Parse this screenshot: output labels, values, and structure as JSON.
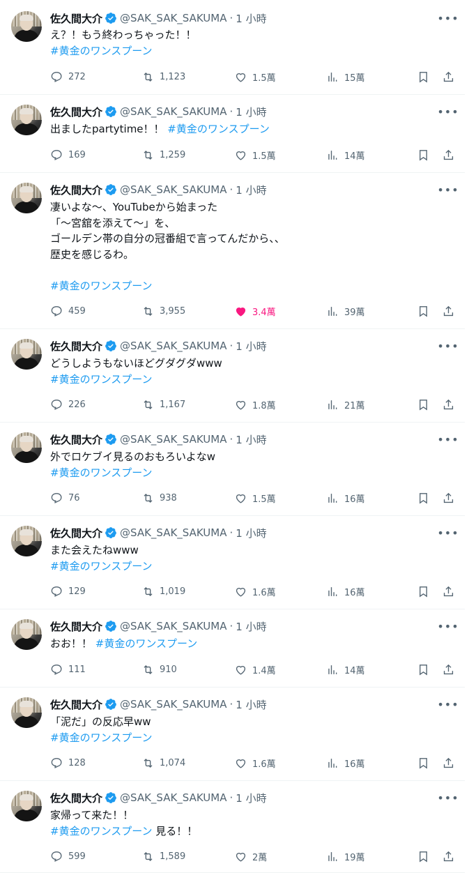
{
  "tweets": [
    {
      "name": "佐久間大介",
      "handle": "@SAK_SAK_SAKUMA",
      "time": "1 小時",
      "lines": [
        "え？！もう終わっちゃった！！"
      ],
      "tag_line": "#黄金のワンスプーン",
      "tag_suffix": "",
      "replies": "272",
      "retweets": "1,123",
      "likes": "1.5萬",
      "views": "15萬",
      "liked": false
    },
    {
      "name": "佐久間大介",
      "handle": "@SAK_SAK_SAKUMA",
      "time": "1 小時",
      "inline_text": "出ましたpartytime！！ ",
      "inline_tag": "#黄金のワンスプーン",
      "replies": "169",
      "retweets": "1,259",
      "likes": "1.5萬",
      "views": "14萬",
      "liked": false
    },
    {
      "name": "佐久間大介",
      "handle": "@SAK_SAK_SAKUMA",
      "time": "1 小時",
      "lines": [
        "凄いよな〜、YouTubeから始まった",
        "「〜宮舘を添えて〜」を、",
        "ゴールデン帯の自分の冠番組で言ってんだから、、",
        "歴史を感じるわ。"
      ],
      "tag_line": "#黄金のワンスプーン",
      "tag_suffix": "",
      "replies": "459",
      "retweets": "3,955",
      "likes": "3.4萬",
      "views": "39萬",
      "liked": true
    },
    {
      "name": "佐久間大介",
      "handle": "@SAK_SAK_SAKUMA",
      "time": "1 小時",
      "lines": [
        "どうしようもないほどグダグダwww"
      ],
      "tag_line": "#黄金のワンスプーン",
      "tag_suffix": "",
      "replies": "226",
      "retweets": "1,167",
      "likes": "1.8萬",
      "views": "21萬",
      "liked": false
    },
    {
      "name": "佐久間大介",
      "handle": "@SAK_SAK_SAKUMA",
      "time": "1 小時",
      "lines": [
        "外でロケブイ見るのおもろいよなw"
      ],
      "tag_line": "#黄金のワンスプーン",
      "tag_suffix": "",
      "replies": "76",
      "retweets": "938",
      "likes": "1.5萬",
      "views": "16萬",
      "liked": false
    },
    {
      "name": "佐久間大介",
      "handle": "@SAK_SAK_SAKUMA",
      "time": "1 小時",
      "lines": [
        "また会えたねwww"
      ],
      "tag_line": "#黄金のワンスプーン",
      "tag_suffix": "",
      "replies": "129",
      "retweets": "1,019",
      "likes": "1.6萬",
      "views": "16萬",
      "liked": false
    },
    {
      "name": "佐久間大介",
      "handle": "@SAK_SAK_SAKUMA",
      "time": "1 小時",
      "inline_text": "おお！！ ",
      "inline_tag": "#黄金のワンスプーン",
      "replies": "111",
      "retweets": "910",
      "likes": "1.4萬",
      "views": "14萬",
      "liked": false
    },
    {
      "name": "佐久間大介",
      "handle": "@SAK_SAK_SAKUMA",
      "time": "1 小時",
      "lines": [
        "「泥だ」の反応早ww"
      ],
      "tag_line": "#黄金のワンスプーン",
      "tag_suffix": "",
      "replies": "128",
      "retweets": "1,074",
      "likes": "1.6萬",
      "views": "16萬",
      "liked": false
    },
    {
      "name": "佐久間大介",
      "handle": "@SAK_SAK_SAKUMA",
      "time": "1 小時",
      "lines": [
        "家帰って来た！！"
      ],
      "tag_line": "#黄金のワンスプーン",
      "tag_suffix": " 見る！！",
      "replies": "599",
      "retweets": "1,589",
      "likes": "2萬",
      "views": "19萬",
      "liked": false
    }
  ],
  "colors": {
    "link": "#1d9bf0",
    "muted": "#536471",
    "like_active": "#f91880",
    "verified": "#1d9bf0"
  },
  "icons": {
    "more": "more-icon",
    "reply": "reply-icon",
    "retweet": "retweet-icon",
    "like": "heart-icon",
    "views": "views-icon",
    "bookmark": "bookmark-icon",
    "share": "share-icon"
  }
}
